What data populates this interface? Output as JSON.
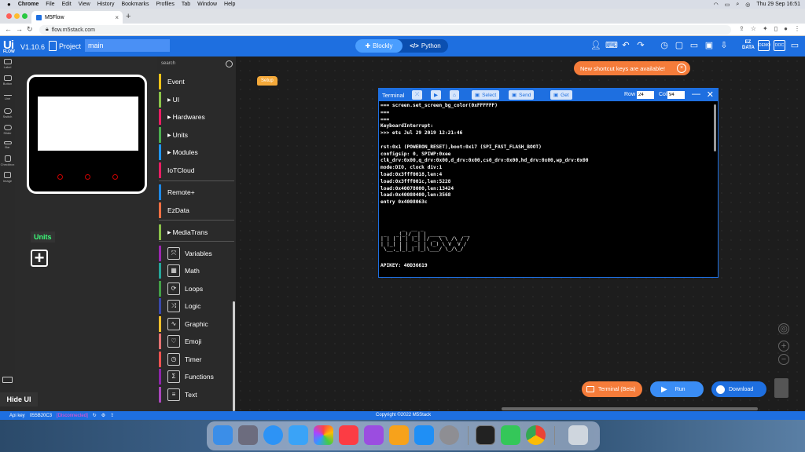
{
  "menubar": {
    "app": "Chrome",
    "items": [
      "File",
      "Edit",
      "View",
      "History",
      "Bookmarks",
      "Profiles",
      "Tab",
      "Window",
      "Help"
    ],
    "clock": "Thu 29 Sep  16:51"
  },
  "browser": {
    "tab_title": "M5Flow",
    "new_tab": "+",
    "url": "flow.m5stack.com"
  },
  "app": {
    "logo": "Ui",
    "logo_sub": "FLOW",
    "version": "V1.10.6",
    "project_label": "Project",
    "file_name": "main",
    "mode_blockly": "Blockly",
    "mode_python": "Python",
    "mode_python_icon": "</>",
    "icons": [
      "user-icon",
      "keyboard-icon",
      "undo-icon",
      "redo-icon",
      "timer-icon",
      "new-file-icon",
      "open-folder-icon",
      "save-icon",
      "download-icon",
      "ezdata-icon",
      "demo-icon",
      "docs-icon",
      "feedback-icon"
    ],
    "ez_label": "EZ DATA",
    "demo_label": "DEMO",
    "doc_label": "DOC",
    "timer_sub": "100"
  },
  "toolstrip": {
    "items": [
      "Label",
      "Button",
      "Line",
      "Switch",
      "Slider",
      "Bar",
      "Checkbox",
      "Image"
    ]
  },
  "device": {
    "units_label": "Units",
    "add_label": "+",
    "hide_ui": "Hide UI"
  },
  "palette": {
    "search": "search",
    "categories": [
      {
        "label": "Event",
        "color": "#f5c518",
        "arrow": ""
      },
      {
        "label": "UI",
        "color": "#8bc34a",
        "arrow": "▶"
      },
      {
        "label": "Hardwares",
        "color": "#e91e63",
        "arrow": "▶"
      },
      {
        "label": "Units",
        "color": "#4caf50",
        "arrow": "▶"
      },
      {
        "label": "Modules",
        "color": "#2196f3",
        "arrow": "▶"
      },
      {
        "label": "IoTCloud",
        "color": "#e91e63",
        "arrow": ""
      },
      {
        "label": "Remote+",
        "color": "#1e88e5",
        "arrow": ""
      },
      {
        "label": "EzData",
        "color": "#ff7043",
        "arrow": ""
      },
      {
        "label": "MediaTrans",
        "color": "#8bc34a",
        "arrow": "▶"
      }
    ],
    "iconcats": [
      {
        "label": "Variables",
        "color": "#9c27b0",
        "icon": "⤧"
      },
      {
        "label": "Math",
        "color": "#26a69a",
        "icon": "▦"
      },
      {
        "label": "Loops",
        "color": "#43a047",
        "icon": "⟳"
      },
      {
        "label": "Logic",
        "color": "#3949ab",
        "icon": "⤨"
      },
      {
        "label": "Graphic",
        "color": "#fbc02d",
        "icon": "∿"
      },
      {
        "label": "Emoji",
        "color": "#e57373",
        "icon": "♡"
      },
      {
        "label": "Timer",
        "color": "#ef5350",
        "icon": "◷"
      },
      {
        "label": "Functions",
        "color": "#8e24aa",
        "icon": "Σ"
      },
      {
        "label": "Text",
        "color": "#ab47bc",
        "icon": "≡"
      }
    ]
  },
  "workspace": {
    "setup_block": "Setup",
    "notice": "New shortcut keys are available!",
    "notice_close": "×"
  },
  "terminal": {
    "title": "Terminal",
    "select": "Select",
    "send": "Send",
    "get": "Get",
    "row_label": "Row",
    "row_value": "24",
    "col_label": "Col",
    "col_value": "94",
    "min": "—",
    "close": "✕",
    "lines": "=== screen.set_screen_bg_color(0xFFFFFF)\n===\n===\nKeyboardInterrupt:\n>>> ets Jul 29 2019 12:21:46\n\nrst:0x1 (POWERON_RESET),boot:0x17 (SPI_FAST_FLASH_BOOT)\nconfigsip: 0, SPIWP:0xee\nclk_drv:0x00,q_drv:0x00,d_drv:0x00,cs0_drv:0x00,hd_drv:0x00,wp_drv:0x00\nmode:DIO, clock div:1\nload:0x3fff0018,len:4\nload:0x3fff001c,len:5228\nload:0x40078000,len:13424\nload:0x40080400,len:3568\nentry 0x4008063c",
    "ascii": "       _  __ _\n _   _(_)/ _| | _____      __\n| | | | | |_| |/ _ \\ \\ /\\ / /\n| |_| | |  _| | (_) \\ V  V /\n \\__,_|_|_| |_|\\___/ \\_/\\_/",
    "apikey": "APIKEY: 40D36619"
  },
  "actions": {
    "terminal": "Terminal (Beta)",
    "run": "Run",
    "download": "Download"
  },
  "status": {
    "api_key_label": "Api key",
    "api_key": "055B20C3",
    "connection": "[Disconnected]",
    "copyright": "Copyright ©2022 M5Stack"
  },
  "colors": {
    "primary": "#1e6fe0",
    "accent_orange": "#f57c3a",
    "disconnected": "#ff4cd2"
  }
}
